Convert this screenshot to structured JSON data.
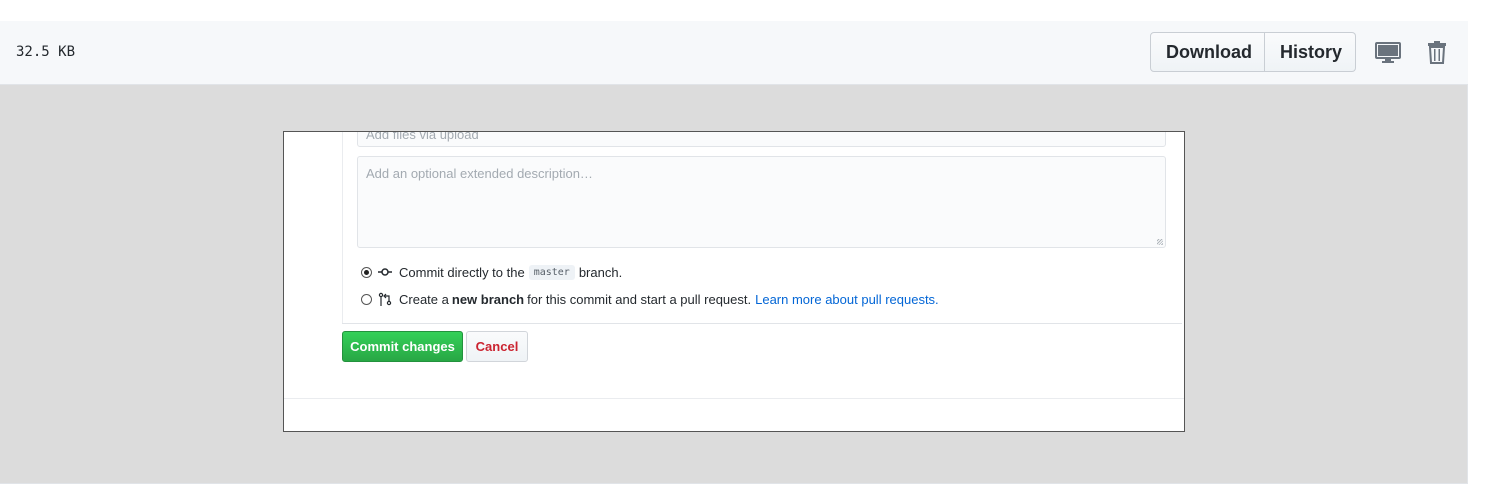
{
  "file_header": {
    "size": "32.5 KB",
    "download_label": "Download",
    "history_label": "History",
    "icons": [
      "desktop-icon",
      "trash-icon"
    ]
  },
  "preview": {
    "commit_input_placeholder": "Add files via upload",
    "description_placeholder": "Add an optional extended description…",
    "option_direct": {
      "prefix": "Commit directly to the",
      "branch": "master",
      "suffix": "branch.",
      "selected": true
    },
    "option_new_branch": {
      "prefix": "Create a",
      "bold": "new branch",
      "suffix": "for this commit and start a pull request.",
      "link": "Learn more about pull requests.",
      "selected": false
    },
    "commit_button": "Commit changes",
    "cancel_button": "Cancel"
  },
  "colors": {
    "commit_green": "#2ea44f",
    "cancel_red": "#cb2431",
    "link_blue": "#0366d6",
    "preview_background": "#dcdcdc"
  }
}
